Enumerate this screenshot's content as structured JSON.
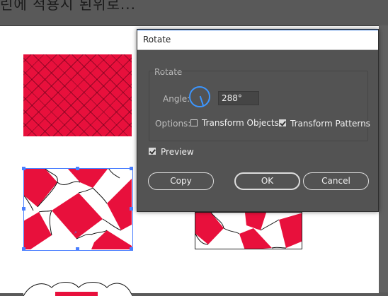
{
  "background_text": "린에 적용시 된위로...",
  "dialog": {
    "title": "Rotate",
    "group_label": "Rotate",
    "angle_label": "Angle:",
    "angle_value": "288°",
    "options_label": "Options:",
    "transform_objects": {
      "label": "Transform Objects",
      "checked": false
    },
    "transform_patterns": {
      "label": "Transform Patterns",
      "checked": true
    },
    "preview": {
      "label": "Preview",
      "checked": true
    },
    "buttons": {
      "copy": "Copy",
      "ok": "OK",
      "cancel": "Cancel"
    }
  },
  "colors": {
    "pattern_red": "#e8103c",
    "dialog_bg": "#535353",
    "accent_blue": "#3c96ff"
  }
}
